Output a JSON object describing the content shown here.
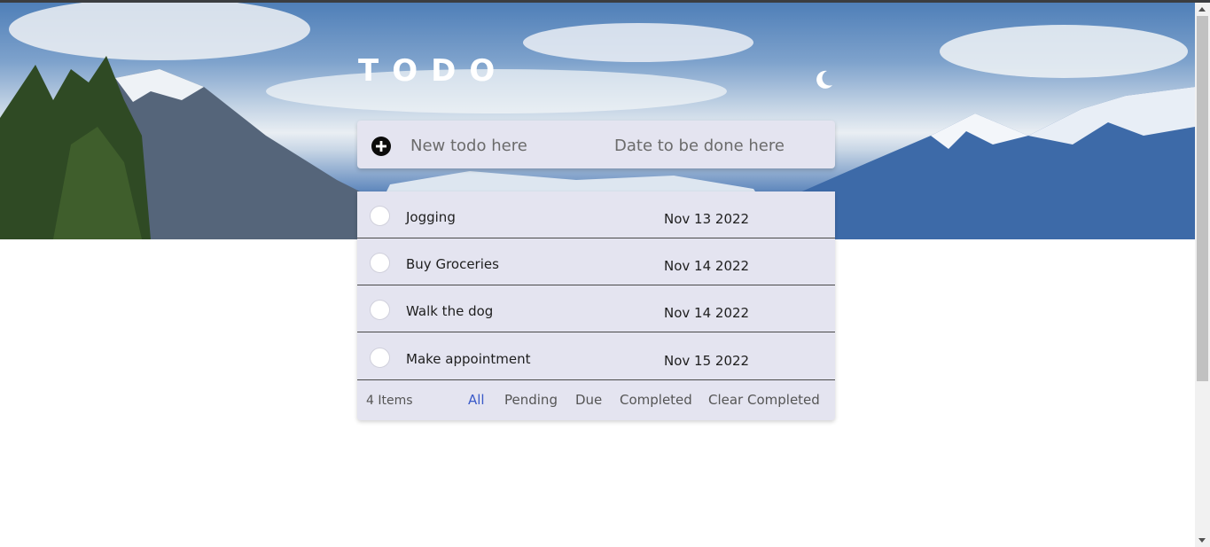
{
  "app": {
    "title": "TODO"
  },
  "header": {
    "theme_toggle_icon": "moon-icon"
  },
  "new_todo": {
    "add_icon": "plus-circle-icon",
    "text_placeholder": "New todo here",
    "date_placeholder": "Date to be done here",
    "text_value": "",
    "date_value": ""
  },
  "todos": [
    {
      "text": "Jogging",
      "date": "Nov 13 2022",
      "completed": false
    },
    {
      "text": "Buy Groceries",
      "date": "Nov 14 2022",
      "completed": false
    },
    {
      "text": "Walk the dog",
      "date": "Nov 14 2022",
      "completed": false
    },
    {
      "text": "Make appointment",
      "date": "Nov 15 2022",
      "completed": false
    }
  ],
  "footer": {
    "count_label": "4 Items",
    "filters": [
      "All",
      "Pending",
      "Due",
      "Completed"
    ],
    "active_filter": "All",
    "clear_label": "Clear Completed"
  },
  "colors": {
    "card": "#e4e4f0",
    "active_filter": "#3a5ac8",
    "title": "#ffffff"
  }
}
